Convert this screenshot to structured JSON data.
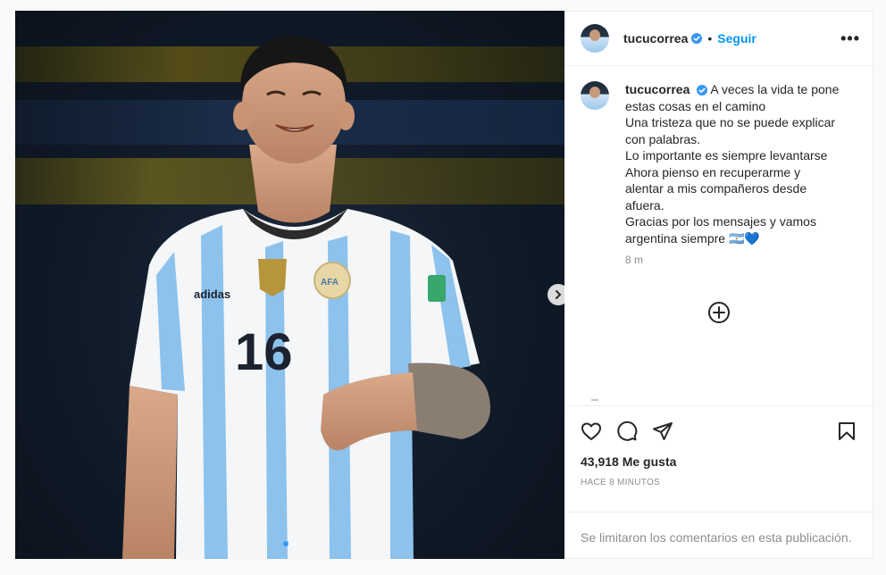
{
  "post": {
    "username": "tucucorrea",
    "follow_label": "Seguir",
    "bullet": "•",
    "more_label": "•••",
    "caption_lines": [
      "A veces la vida te pone",
      "estas cosas en el camino",
      "Una tristeza que no se puede explicar",
      "con palabras.",
      "Lo importante es siempre levantarse",
      "Ahora pienso en recuperarme y",
      "alentar a mis compañeros desde",
      "afuera.",
      "Gracias por los mensajes y vamos",
      "argentina siempre 🇦🇷💙"
    ],
    "time_ago": "8 m",
    "likes": "43,918 Me gusta",
    "posted": "HACE 8 MINUTOS",
    "comments_limited": "Se limitaron los comentarios en esta publicación."
  },
  "media": {
    "jersey_number": "16",
    "brand_text": "adidas",
    "crest_text": "AFA"
  },
  "icons": {
    "verified": "verified-badge-icon",
    "like": "heart-icon",
    "comment": "comment-bubble-icon",
    "share": "paper-plane-icon",
    "save": "bookmark-icon",
    "add": "plus-circle-icon",
    "next": "chevron-right-icon"
  },
  "colors": {
    "accent": "#0095f6",
    "verified": "#3897f0",
    "muted": "#8e8e8e",
    "text": "#262626"
  }
}
